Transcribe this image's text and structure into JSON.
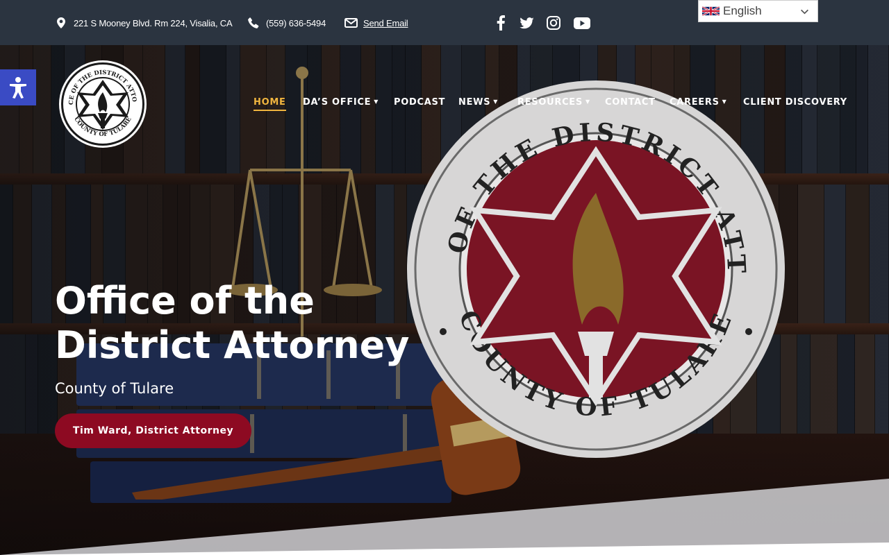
{
  "topbar": {
    "address": "221 S Mooney Blvd. Rm 224, Visalia, CA",
    "phone": "(559) 636-5494",
    "email_label": "Send Email",
    "social": [
      "facebook-icon",
      "twitter-icon",
      "instagram-icon",
      "youtube-icon"
    ],
    "language": "English"
  },
  "nav": {
    "home": "HOME",
    "das_office": "DA’S OFFICE",
    "podcast": "PODCAST",
    "news": "NEWS",
    "resources": "RESOURCES",
    "contact": "CONTACT",
    "careers": "CAREERS",
    "client_discovery": "CLIENT DISCOVERY"
  },
  "logo": {
    "top_text": "OFFICE OF THE DISTRICT ATTORNEY",
    "bottom_text": "COUNTY OF TULARE"
  },
  "hero": {
    "title_line1": "Office of the",
    "title_line2": "District Attorney",
    "subtitle": "County of Tulare",
    "button_label": "Tim Ward, District Attorney"
  },
  "seal": {
    "top_text": "OFFICE OF THE DISTRICT ATTORNEY",
    "bottom_text": "COUNTY OF TULARE"
  },
  "colors": {
    "topbar_bg": "#2b3440",
    "nav_active": "#f0b53f",
    "button_bg": "#8d0a22",
    "a11y_bg": "#3a4bc4",
    "seal_red": "#7a1424"
  }
}
